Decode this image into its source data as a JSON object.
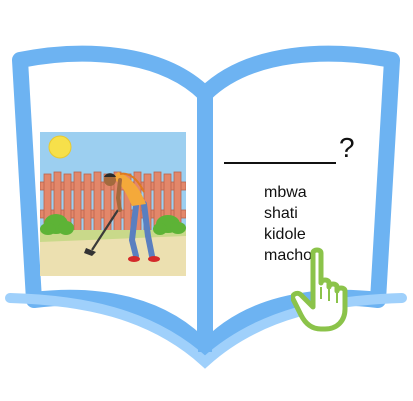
{
  "colors": {
    "book_blue": "#6db3f2",
    "book_blue_light": "#9fd0fb",
    "pointer_green": "#8bc34a",
    "sky": "#8fc8ea",
    "sun": "#f7e04a",
    "fence": "#e3876a",
    "grass": "#6fbf3f",
    "path": "#e9dba7"
  },
  "illustration": {
    "subject": "person-hoeing-garden"
  },
  "question": {
    "mark": "?"
  },
  "options": [
    "mbwa",
    "shati",
    "kidole",
    "macho"
  ],
  "pointer": {
    "icon": "hand-pointer-icon",
    "target_option": "macho"
  }
}
